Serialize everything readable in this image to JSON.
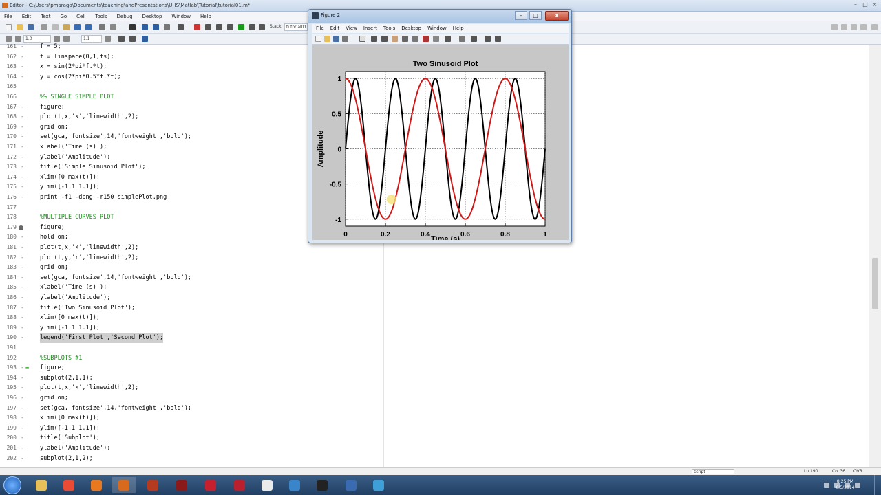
{
  "editor": {
    "title": "Editor - C:\\Users\\pmarago\\Documents\\teaching\\andPresentations\\UHS\\Matlab\\Tutorial\\tutorial01.m*",
    "menu": [
      "File",
      "Edit",
      "Text",
      "Go",
      "Cell",
      "Tools",
      "Debug",
      "Desktop",
      "Window",
      "Help"
    ],
    "toolbar": {
      "cell_value_1": "1.0",
      "cell_value_2": "1.1",
      "stack_label": "Stack:",
      "stack_value": "tutorial01"
    },
    "status": {
      "mode": "script",
      "ln_label": "Ln",
      "ln": "190",
      "col_label": "Col",
      "col": "36",
      "ovr": "OVR"
    },
    "lines": [
      {
        "n": "161",
        "t": "f = 5;"
      },
      {
        "n": "162",
        "t": "t = linspace(0,1,fs);"
      },
      {
        "n": "163",
        "t": "x = sin(2*pi*f.*t);"
      },
      {
        "n": "164",
        "t": "y = cos(2*pi*0.5*f.*t);"
      },
      {
        "n": "165",
        "t": ""
      },
      {
        "n": "166",
        "t": "%% SINGLE SIMPLE PLOT",
        "c": true
      },
      {
        "n": "167",
        "t": "figure;"
      },
      {
        "n": "168",
        "t": "plot(t,x,'k','linewidth',2);"
      },
      {
        "n": "169",
        "t": "grid on;"
      },
      {
        "n": "170",
        "t": "set(gca,'fontsize',14,'fontweight','bold');"
      },
      {
        "n": "171",
        "t": "xlabel('Time (s)');"
      },
      {
        "n": "172",
        "t": "ylabel('Amplitude');"
      },
      {
        "n": "173",
        "t": "title('Simple Sinusoid Plot');"
      },
      {
        "n": "174",
        "t": "xlim([0 max(t)]);"
      },
      {
        "n": "175",
        "t": "ylim([-1.1 1.1]);"
      },
      {
        "n": "176",
        "t": "print -f1 -dpng -r150 simplePlot.png"
      },
      {
        "n": "177",
        "t": ""
      },
      {
        "n": "178",
        "t": "%MULTIPLE CURVES PLOT",
        "c": true
      },
      {
        "n": "179",
        "t": "figure;",
        "bp": true
      },
      {
        "n": "180",
        "t": "hold on;"
      },
      {
        "n": "181",
        "t": "plot(t,x,'k','linewidth',2);"
      },
      {
        "n": "182",
        "t": "plot(t,y,'r','linewidth',2);"
      },
      {
        "n": "183",
        "t": "grid on;"
      },
      {
        "n": "184",
        "t": "set(gca,'fontsize',14,'fontweight','bold');"
      },
      {
        "n": "185",
        "t": "xlabel('Time (s)');"
      },
      {
        "n": "186",
        "t": "ylabel('Amplitude');"
      },
      {
        "n": "187",
        "t": "title('Two Sinusoid Plot');"
      },
      {
        "n": "188",
        "t": "xlim([0 max(t)]);"
      },
      {
        "n": "189",
        "t": "ylim([-1.1 1.1]);"
      },
      {
        "n": "190",
        "t": "legend('First Plot','Second Plot');",
        "hl": true
      },
      {
        "n": "191",
        "t": ""
      },
      {
        "n": "192",
        "t": "%SUBPLOTS #1",
        "c": true
      },
      {
        "n": "193",
        "t": "figure;",
        "arrow": true
      },
      {
        "n": "194",
        "t": "subplot(2,1,1);"
      },
      {
        "n": "195",
        "t": "plot(t,x,'k','linewidth',2);"
      },
      {
        "n": "196",
        "t": "grid on;"
      },
      {
        "n": "197",
        "t": "set(gca,'fontsize',14,'fontweight','bold');"
      },
      {
        "n": "198",
        "t": "xlim([0 max(t)]);"
      },
      {
        "n": "199",
        "t": "ylim([-1.1 1.1]);"
      },
      {
        "n": "200",
        "t": "title('Subplot');"
      },
      {
        "n": "201",
        "t": "ylabel('Amplitude');"
      },
      {
        "n": "202",
        "t": "subplot(2,1,2);"
      }
    ]
  },
  "figure": {
    "title": "Figure 2",
    "menu": [
      "File",
      "Edit",
      "View",
      "Insert",
      "Tools",
      "Desktop",
      "Window",
      "Help"
    ],
    "close_glyph": "x",
    "min_glyph": "–",
    "max_glyph": "□"
  },
  "chart_data": {
    "type": "line",
    "title": "Two Sinusoid Plot",
    "xlabel": "Time (s)",
    "ylabel": "Amplitude",
    "xlim": [
      0,
      1
    ],
    "ylim": [
      -1.1,
      1.1
    ],
    "xticks": [
      "0",
      "0.2",
      "0.4",
      "0.6",
      "0.8",
      "1"
    ],
    "yticks": [
      "-1",
      "-0.5",
      "0",
      "0.5",
      "1"
    ],
    "grid": true,
    "series": [
      {
        "color": "#000000",
        "frequency": 5,
        "function": "sin"
      },
      {
        "color": "#d01818",
        "frequency": 2.5,
        "function": "cos"
      }
    ]
  },
  "taskbar": {
    "items": [
      "explorer",
      "chrome",
      "firefox",
      "matlab",
      "app",
      "app",
      "quicken",
      "mendeley",
      "app",
      "app",
      "terminal",
      "app",
      "app"
    ],
    "clock_time": "8:25 PM",
    "clock_date": "6/5/2014"
  }
}
